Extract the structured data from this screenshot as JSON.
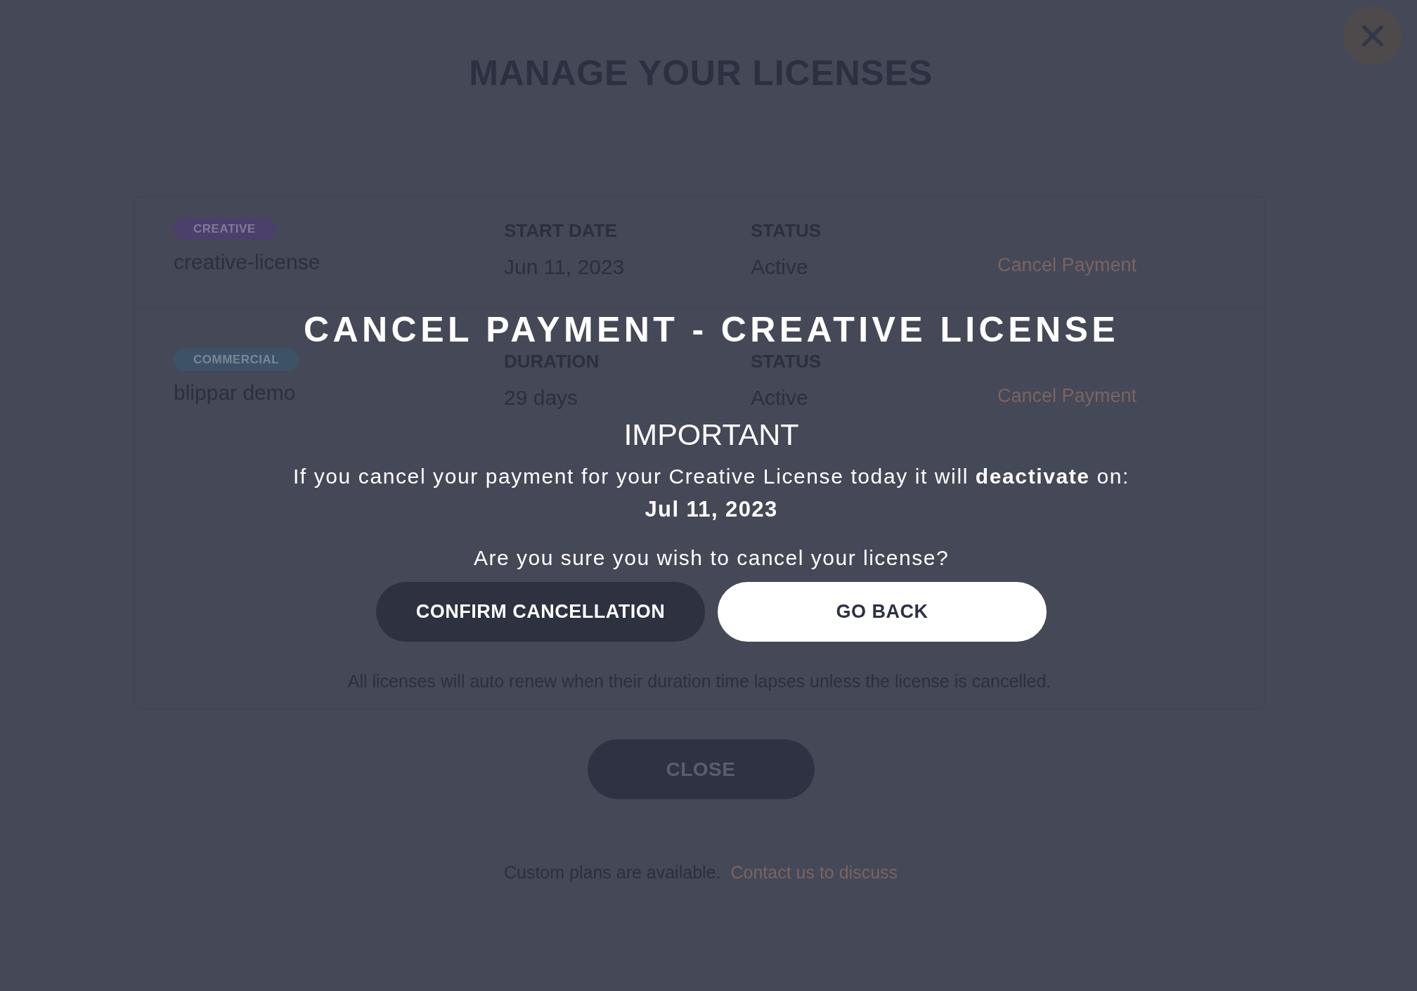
{
  "page": {
    "title": "MANAGE YOUR LICENSES"
  },
  "licenses": [
    {
      "tag": {
        "label": "CREATIVE",
        "color": "#4b3f6b"
      },
      "name": "creative-license",
      "fields": [
        {
          "label": "START DATE",
          "value": "Jun 11, 2023"
        },
        {
          "label": "STATUS",
          "value": "Active"
        }
      ],
      "action": "Cancel Payment"
    },
    {
      "tag": {
        "label": "COMMERCIAL",
        "color": "#3d5267"
      },
      "name": "blippar demo",
      "fields": [
        {
          "label": "DURATION",
          "value": "29 days"
        },
        {
          "label": "STATUS",
          "value": "Active"
        }
      ],
      "action": "Cancel Payment"
    }
  ],
  "renewal_note": "All licenses will auto renew when their duration time lapses unless the license is cancelled.",
  "close_button": "CLOSE",
  "footer": {
    "text": "Custom plans are available.",
    "link": "Contact us to discuss"
  },
  "dialog": {
    "title": "CANCEL PAYMENT - CREATIVE LICENSE",
    "heading": "IMPORTANT",
    "message": "If you cancel your payment for your Creative License today it will **deactivate** on:",
    "deactivation_date": "Jul 11, 2023",
    "question": "Are you sure you wish to cancel your license?",
    "buttons": [
      {
        "label": "CONFIRM CANCELLATION",
        "kind": "primary"
      },
      {
        "label": "GO BACK",
        "kind": "secondary"
      }
    ]
  }
}
